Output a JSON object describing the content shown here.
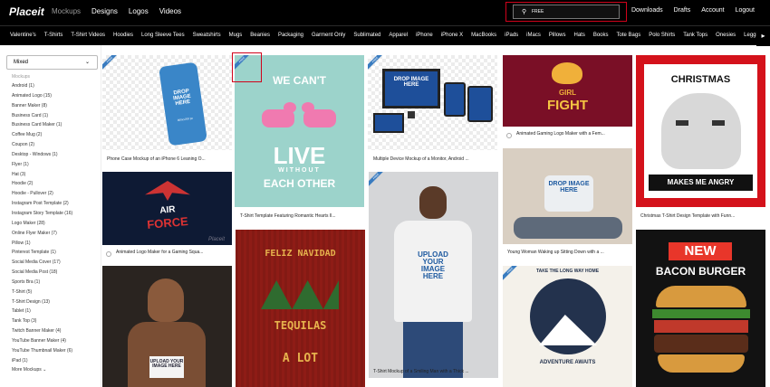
{
  "header": {
    "logo": "Placeit",
    "nav": [
      "Mockups",
      "Designs",
      "Logos",
      "Videos"
    ],
    "search_value": "FREE",
    "right_nav": [
      "Downloads",
      "Drafts",
      "Account",
      "Logout"
    ]
  },
  "categories": [
    "Valentine's",
    "T-Shirts",
    "T-Shirt Videos",
    "Hoodies",
    "Long Sleeve Tees",
    "Sweatshirts",
    "Mugs",
    "Beanies",
    "Packaging",
    "Garment Only",
    "Sublimated",
    "Apparel",
    "iPhone",
    "iPhone X",
    "MacBooks",
    "iPads",
    "iMacs",
    "Pillows",
    "Hats",
    "Books",
    "Tote Bags",
    "Polo Shirts",
    "Tank Tops",
    "Onesies",
    "Leggings"
  ],
  "sidebar": {
    "filter": "Mixed",
    "section_title": "Mockups",
    "items": [
      "Android (1)",
      "Animated Logo (15)",
      "Banner Maker (8)",
      "Business Card (1)",
      "Business Card Maker (1)",
      "Coffee Mug (2)",
      "Coupon (2)",
      "Desktop - Windows (1)",
      "Flyer (1)",
      "Hat (3)",
      "Hoodie (2)",
      "Hoodie - Pullover (2)",
      "Instagram Post Template (2)",
      "Instagram Story Template (16)",
      "Logo Maker (28)",
      "Online Flyer Maker (7)",
      "Pillow (1)",
      "Pinterest Template (1)",
      "Social Media Cover (17)",
      "Social Media Post (18)",
      "Sports Bra (1)",
      "T-Shirt (5)",
      "T-Shirt Design (13)",
      "Tablet (1)",
      "Tank Top (3)",
      "Twitch Banner Maker (4)",
      "YouTube Banner Maker (4)",
      "YouTube Thumbnail Maker (6)",
      "iPad (1)"
    ],
    "more": "More Mockups"
  },
  "badge": "FREE",
  "tiles": {
    "phone_cap": "Phone Case Mockup of an iPhone 6 Leaning O...",
    "airforce_cap": "Animated Logo Maker for a Gaming Squa...",
    "tee1_cap": "T-Shirt Template Featuring Romantic Hearts Il...",
    "device_cap": "Multiple Device Mockup of a Monitor, Android ...",
    "man_cap": "T-Shirt Mockup of a Smiling Man with a Thick ...",
    "girlfight_cap": "Animated Gaming Logo Maker with a Fem...",
    "pillow_cap": "Young Woman Waking up Sitting Down with a ...",
    "christmas_cap": "Christmas T-Shirt Design Template with Funn..."
  },
  "art": {
    "drop": "DROP IMAGE HERE",
    "drop_sub": "900x1200 px",
    "cant": "WE CAN'T",
    "live": "LIVE",
    "without": "WITHOUT",
    "each": "EACH OTHER",
    "air": "AIR",
    "force": "FORCE",
    "girl": "GIRL",
    "fight": "FIGHT",
    "navidad": "FELIZ NAVIDAD",
    "tequilas": "TEQUILAS",
    "alot": "A LOT",
    "upload": "UPLOAD YOUR IMAGE HERE",
    "christmas": "CHRISTMAS",
    "angry": "MAKES ME ANGRY",
    "new": "NEW",
    "bacon": "BACON BURGER",
    "long_way": "TAKE THE LONG WAY HOME",
    "adventure": "ADVENTURE AWAITS",
    "watermark": "Placeit"
  },
  "colors": {
    "accent_red": "#d0021b",
    "badge_blue": "#3a7cc0",
    "mint": "#9cd3cb",
    "pink": "#f07ab0"
  }
}
